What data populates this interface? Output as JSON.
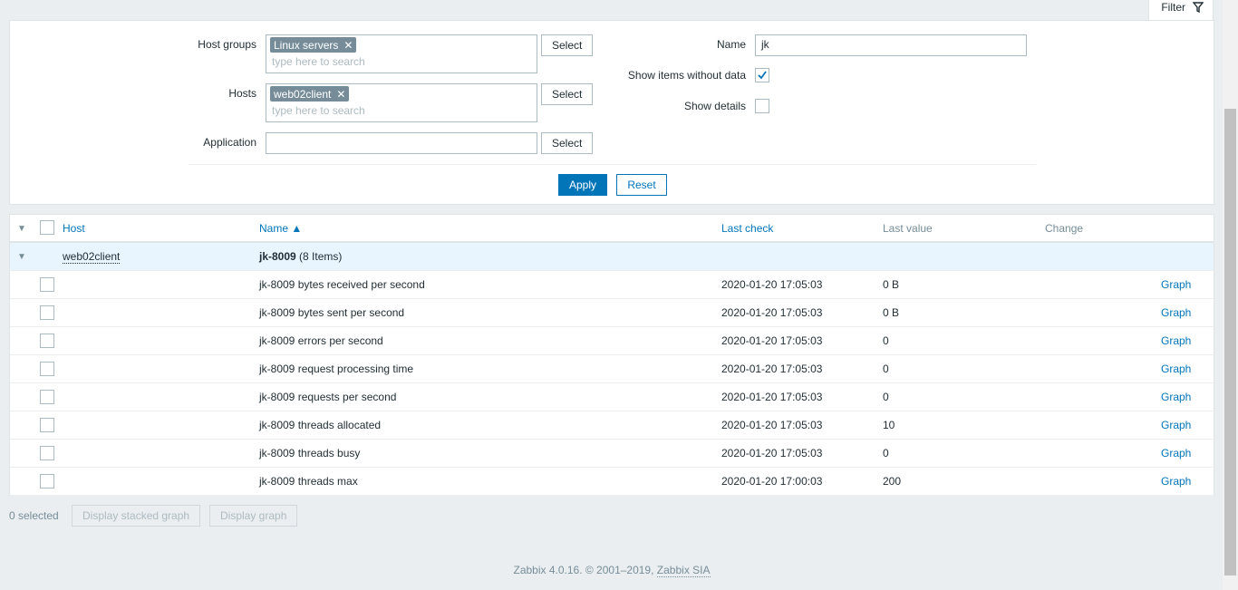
{
  "filter_tab": {
    "label": "Filter"
  },
  "filter": {
    "host_groups": {
      "label": "Host groups",
      "chip": "Linux servers",
      "placeholder": "type here to search",
      "button": "Select"
    },
    "hosts": {
      "label": "Hosts",
      "chip": "web02client",
      "placeholder": "type here to search",
      "button": "Select"
    },
    "application": {
      "label": "Application",
      "value": "",
      "button": "Select"
    },
    "name": {
      "label": "Name",
      "value": "jk"
    },
    "show_items_without_data": {
      "label": "Show items without data",
      "checked": true
    },
    "show_details": {
      "label": "Show details",
      "checked": false
    },
    "apply": "Apply",
    "reset": "Reset"
  },
  "table": {
    "headers": {
      "host": "Host",
      "name": "Name ▲",
      "last_check": "Last check",
      "last_value": "Last value",
      "change": "Change"
    },
    "group": {
      "host": "web02client",
      "app": "jk-8009",
      "count": "(8 Items)"
    },
    "rows": [
      {
        "name": "jk-8009 bytes received per second",
        "last_check": "2020-01-20 17:05:03",
        "last_value": "0 B",
        "action": "Graph"
      },
      {
        "name": "jk-8009 bytes sent per second",
        "last_check": "2020-01-20 17:05:03",
        "last_value": "0 B",
        "action": "Graph"
      },
      {
        "name": "jk-8009 errors per second",
        "last_check": "2020-01-20 17:05:03",
        "last_value": "0",
        "action": "Graph"
      },
      {
        "name": "jk-8009 request processing time",
        "last_check": "2020-01-20 17:05:03",
        "last_value": "0",
        "action": "Graph"
      },
      {
        "name": "jk-8009 requests per second",
        "last_check": "2020-01-20 17:05:03",
        "last_value": "0",
        "action": "Graph"
      },
      {
        "name": "jk-8009 threads allocated",
        "last_check": "2020-01-20 17:05:03",
        "last_value": "10",
        "action": "Graph"
      },
      {
        "name": "jk-8009 threads busy",
        "last_check": "2020-01-20 17:05:03",
        "last_value": "0",
        "action": "Graph"
      },
      {
        "name": "jk-8009 threads max",
        "last_check": "2020-01-20 17:00:03",
        "last_value": "200",
        "action": "Graph"
      }
    ]
  },
  "actions": {
    "selected": "0 selected",
    "stacked_graph": "Display stacked graph",
    "graph": "Display graph"
  },
  "footer": {
    "text": "Zabbix 4.0.16. © 2001–2019,",
    "link": "Zabbix SIA"
  },
  "colors": {
    "accent": "#0275b8",
    "group_row": "#e8f5ff",
    "background": "#ebeef0"
  }
}
